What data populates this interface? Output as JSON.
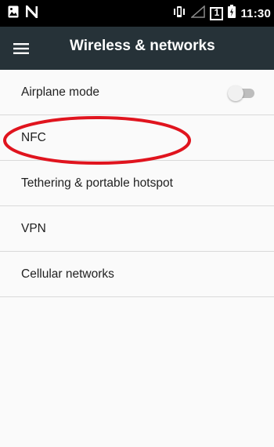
{
  "status_bar": {
    "time": "11:30",
    "sim_slot_badge": "1",
    "left_icons": [
      "image-icon",
      "n-logo-icon"
    ],
    "right_icons": [
      "vibrate-icon",
      "no-signal-icon",
      "sim-1-icon",
      "battery-icon"
    ]
  },
  "app_bar": {
    "title": "Wireless & networks",
    "menu_icon": "hamburger-menu-icon"
  },
  "settings": {
    "items": [
      {
        "label": "Airplane mode",
        "toggle_on": false
      },
      {
        "label": "NFC"
      },
      {
        "label": "Tethering & portable hotspot"
      },
      {
        "label": "VPN"
      },
      {
        "label": "Cellular networks"
      }
    ]
  },
  "colors": {
    "status_bar_bg": "#000000",
    "app_bar_bg": "#263238",
    "list_bg": "#fafafa",
    "divider": "#d9d9d9",
    "highlight_annotation": "#e0141e"
  }
}
